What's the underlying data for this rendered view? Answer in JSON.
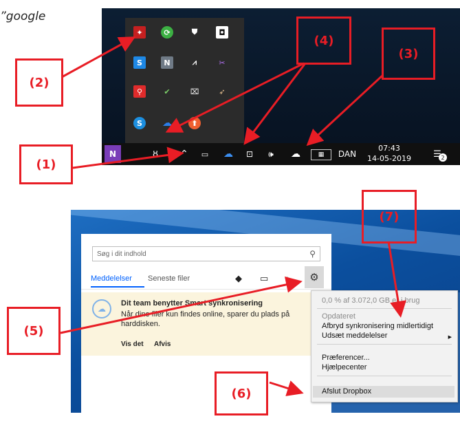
{
  "corner_text": "”google",
  "tray_overflow": {
    "icons": [
      {
        "name": "dropbox-notif-icon",
        "glyph": "✦",
        "color": "#e33"
      },
      {
        "name": "green-sync-icon",
        "glyph": "⟳",
        "color": "#3cb043"
      },
      {
        "name": "shield-warning-icon",
        "glyph": "⛊",
        "color": "#fff"
      },
      {
        "name": "dolby-icon",
        "glyph": "◘",
        "color": "#fff"
      },
      {
        "name": "skype-business-icon",
        "glyph": "S",
        "color": "#1e88e5"
      },
      {
        "name": "n-app-icon",
        "glyph": "N",
        "color": "#c0c8d0"
      },
      {
        "name": "chart-app-icon",
        "glyph": "⩘",
        "color": "#fff"
      },
      {
        "name": "bluetooth-scissors-icon",
        "glyph": "✂",
        "color": "#b070f0"
      },
      {
        "name": "red-search-icon",
        "glyph": "⚲",
        "color": "#e02b2b"
      },
      {
        "name": "check-drive-icon",
        "glyph": "✔",
        "color": "#7cd069"
      },
      {
        "name": "usb-icon",
        "glyph": "⌧",
        "color": "#ddd"
      },
      {
        "name": "feather-icon",
        "glyph": "➶",
        "color": "#e8c090"
      },
      {
        "name": "skype-icon",
        "glyph": "S",
        "color": "#1c8fe0"
      },
      {
        "name": "onedrive-overflow-icon",
        "glyph": "☁",
        "color": "#2b7de9"
      },
      {
        "name": "update-icon",
        "glyph": "⬆",
        "color": "#f06030"
      }
    ]
  },
  "taskbar": {
    "language": "DAN",
    "time": "07:43",
    "date": "14-05-2019",
    "notifications_count": "2"
  },
  "dropbox_panel": {
    "search_placeholder": "Søg i dit indhold",
    "tab_notifications": "Meddelelser",
    "tab_recent": "Seneste filer",
    "notification": {
      "title": "Dit team benytter Smart synkronisering",
      "body": "Når dine filer kun findes online, sparer du plads på harddisken.",
      "view_link": "Vis det",
      "dismiss_link": "Afvis"
    }
  },
  "settings_menu": {
    "usage": "0,0 % af 3.072,0 GB er i brug",
    "status": "Opdateret",
    "pause_sync": "Afbryd synkronisering midlertidigt",
    "snooze_notifications": "Udsæt meddelelser",
    "preferences": "Præferencer...",
    "help_center": "Hjælpecenter",
    "quit": "Afslut Dropbox"
  },
  "annotations": {
    "label_1": "(1)",
    "label_2": "(2)",
    "label_3": "(3)",
    "label_4": "(4)",
    "label_5": "(5)",
    "label_6": "(6)",
    "label_7": "(7)"
  },
  "colors": {
    "annotation_red": "#e81d25",
    "dropbox_blue": "#0061fe",
    "taskbar_black": "#101010",
    "notification_bg": "#fbf4dd"
  }
}
